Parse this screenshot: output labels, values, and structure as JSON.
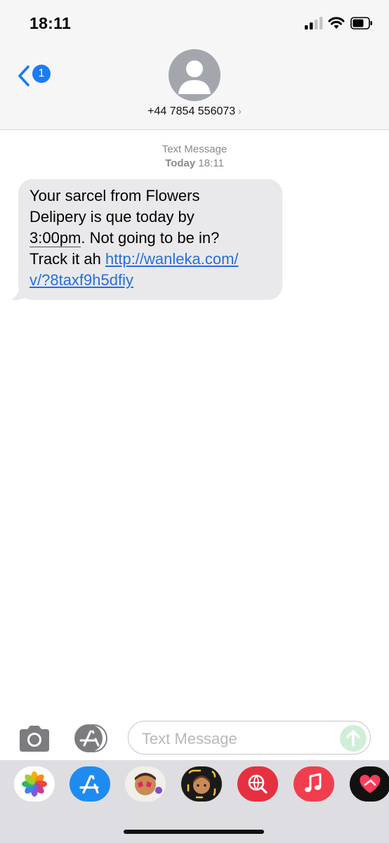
{
  "status_bar": {
    "time": "18:11"
  },
  "header": {
    "back_badge": "1",
    "contact": "+44 7854 556073",
    "chevron": "›"
  },
  "conversation": {
    "label": "Text Message",
    "date": "Today",
    "time": "18:11",
    "message": {
      "line1": "Your sarcel from Flowers",
      "line2": "Delipery is que today by",
      "line3_time": "3:00pm",
      "line3_rest": ". Not going to be in?",
      "line4_text": "Track it ah ",
      "link_part1": "http://wanleka.com/",
      "link_part2": "v/?8taxf9h5dfiy"
    }
  },
  "input_bar": {
    "placeholder": "Text Message"
  },
  "app_strip": {
    "apps": [
      "photos-app",
      "app-store-app",
      "memoji-stickers-app",
      "memoji-app",
      "web-images-app",
      "music-app",
      "digital-touch-app"
    ]
  },
  "colors": {
    "accent": "#1a7cf5",
    "link": "#2670d8",
    "bubble": "#e9e9eb",
    "send": "#cfeed8"
  }
}
